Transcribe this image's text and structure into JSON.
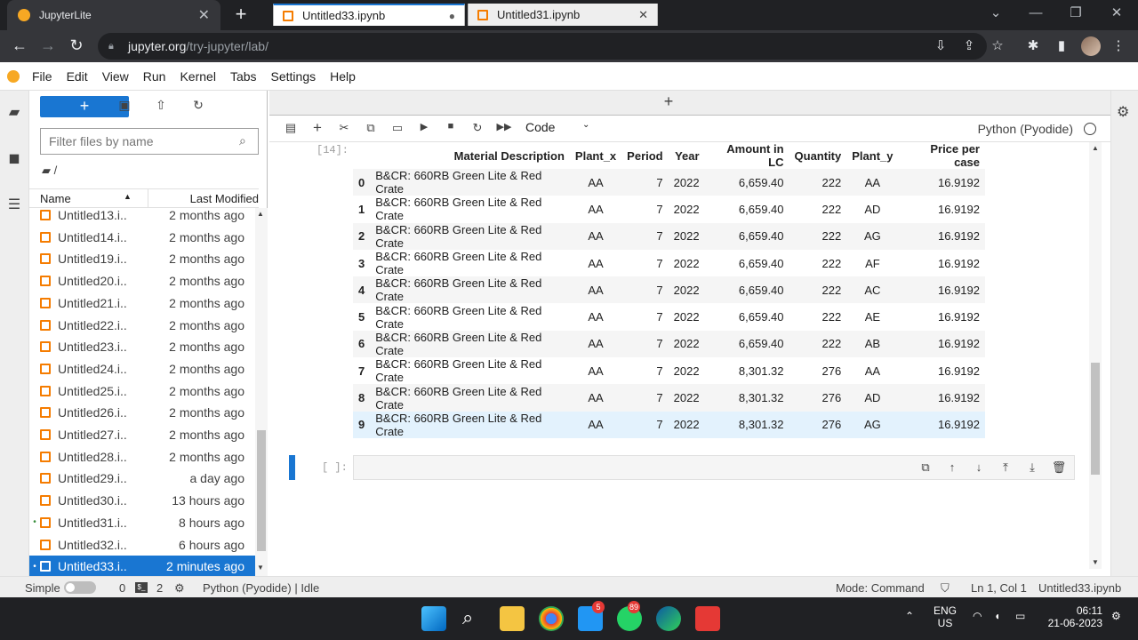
{
  "browser": {
    "tab_title": "JupyterLite",
    "url_host": "jupyter.org",
    "url_path": "/try-jupyter/lab/"
  },
  "menu": [
    "File",
    "Edit",
    "View",
    "Run",
    "Kernel",
    "Tabs",
    "Settings",
    "Help"
  ],
  "filebrowser": {
    "new_label": "+",
    "filter_placeholder": "Filter files by name",
    "breadcrumb": "/",
    "col_name": "Name",
    "col_modified": "Last Modified",
    "files": [
      {
        "name": "Untitled13.i...",
        "modified": "2 months ago",
        "running": false,
        "selected": false
      },
      {
        "name": "Untitled14.i...",
        "modified": "2 months ago",
        "running": false,
        "selected": false
      },
      {
        "name": "Untitled19.i...",
        "modified": "2 months ago",
        "running": false,
        "selected": false
      },
      {
        "name": "Untitled20.i...",
        "modified": "2 months ago",
        "running": false,
        "selected": false
      },
      {
        "name": "Untitled21.i...",
        "modified": "2 months ago",
        "running": false,
        "selected": false
      },
      {
        "name": "Untitled22.i...",
        "modified": "2 months ago",
        "running": false,
        "selected": false
      },
      {
        "name": "Untitled23.i...",
        "modified": "2 months ago",
        "running": false,
        "selected": false
      },
      {
        "name": "Untitled24.i...",
        "modified": "2 months ago",
        "running": false,
        "selected": false
      },
      {
        "name": "Untitled25.i...",
        "modified": "2 months ago",
        "running": false,
        "selected": false
      },
      {
        "name": "Untitled26.i...",
        "modified": "2 months ago",
        "running": false,
        "selected": false
      },
      {
        "name": "Untitled27.i...",
        "modified": "2 months ago",
        "running": false,
        "selected": false
      },
      {
        "name": "Untitled28.i...",
        "modified": "2 months ago",
        "running": false,
        "selected": false
      },
      {
        "name": "Untitled29.i...",
        "modified": "a day ago",
        "running": false,
        "selected": false
      },
      {
        "name": "Untitled30.i...",
        "modified": "13 hours ago",
        "running": false,
        "selected": false
      },
      {
        "name": "Untitled31.i...",
        "modified": "8 hours ago",
        "running": true,
        "selected": false
      },
      {
        "name": "Untitled32.i...",
        "modified": "6 hours ago",
        "running": false,
        "selected": false
      },
      {
        "name": "Untitled33.i...",
        "modified": "2 minutes ago",
        "running": true,
        "selected": true
      }
    ]
  },
  "doc_tabs": [
    {
      "label": "Untitled33.ipynb",
      "active": true,
      "status": "●"
    },
    {
      "label": "Untitled31.ipynb",
      "active": false,
      "status": "✕"
    }
  ],
  "toolbar": {
    "cell_type": "Code",
    "kernel_name": "Python (Pyodide)"
  },
  "output": {
    "prompt": "[14]:",
    "columns": [
      "",
      "Material Description",
      "Plant_x",
      "Period",
      "Year",
      "Amount in LC",
      "Quantity",
      "Plant_y",
      "Price per case"
    ],
    "rows": [
      [
        "0",
        "B&CR: 660RB Green Lite & Red Crate",
        "AA",
        "7",
        "2022",
        "6,659.40",
        "222",
        "AA",
        "16.9192"
      ],
      [
        "1",
        "B&CR: 660RB Green Lite & Red Crate",
        "AA",
        "7",
        "2022",
        "6,659.40",
        "222",
        "AD",
        "16.9192"
      ],
      [
        "2",
        "B&CR: 660RB Green Lite & Red Crate",
        "AA",
        "7",
        "2022",
        "6,659.40",
        "222",
        "AG",
        "16.9192"
      ],
      [
        "3",
        "B&CR: 660RB Green Lite & Red Crate",
        "AA",
        "7",
        "2022",
        "6,659.40",
        "222",
        "AF",
        "16.9192"
      ],
      [
        "4",
        "B&CR: 660RB Green Lite & Red Crate",
        "AA",
        "7",
        "2022",
        "6,659.40",
        "222",
        "AC",
        "16.9192"
      ],
      [
        "5",
        "B&CR: 660RB Green Lite & Red Crate",
        "AA",
        "7",
        "2022",
        "6,659.40",
        "222",
        "AE",
        "16.9192"
      ],
      [
        "6",
        "B&CR: 660RB Green Lite & Red Crate",
        "AA",
        "7",
        "2022",
        "6,659.40",
        "222",
        "AB",
        "16.9192"
      ],
      [
        "7",
        "B&CR: 660RB Green Lite & Red Crate",
        "AA",
        "7",
        "2022",
        "8,301.32",
        "276",
        "AA",
        "16.9192"
      ],
      [
        "8",
        "B&CR: 660RB Green Lite & Red Crate",
        "AA",
        "7",
        "2022",
        "8,301.32",
        "276",
        "AD",
        "16.9192"
      ],
      [
        "9",
        "B&CR: 660RB Green Lite & Red Crate",
        "AA",
        "7",
        "2022",
        "8,301.32",
        "276",
        "AG",
        "16.9192"
      ]
    ],
    "highlighted_row": "9"
  },
  "empty_cell_prompt": "[ ]:",
  "statusbar": {
    "simple_label": "Simple",
    "kernels_count": "0",
    "terminals_count": "2",
    "kernel_status": "Python (Pyodide) | Idle",
    "mode": "Mode: Command",
    "position": "Ln 1, Col 1",
    "filename": "Untitled33.ipynb"
  },
  "taskbar": {
    "mail_badge": "5",
    "whatsapp_badge": "89",
    "lang": "ENG",
    "region": "US",
    "time": "06:11",
    "date": "21-06-2023"
  },
  "colors": {
    "accent": "#1976d2",
    "notebook_icon": "#f57c00",
    "jupyter_logo": "#f7a823"
  }
}
